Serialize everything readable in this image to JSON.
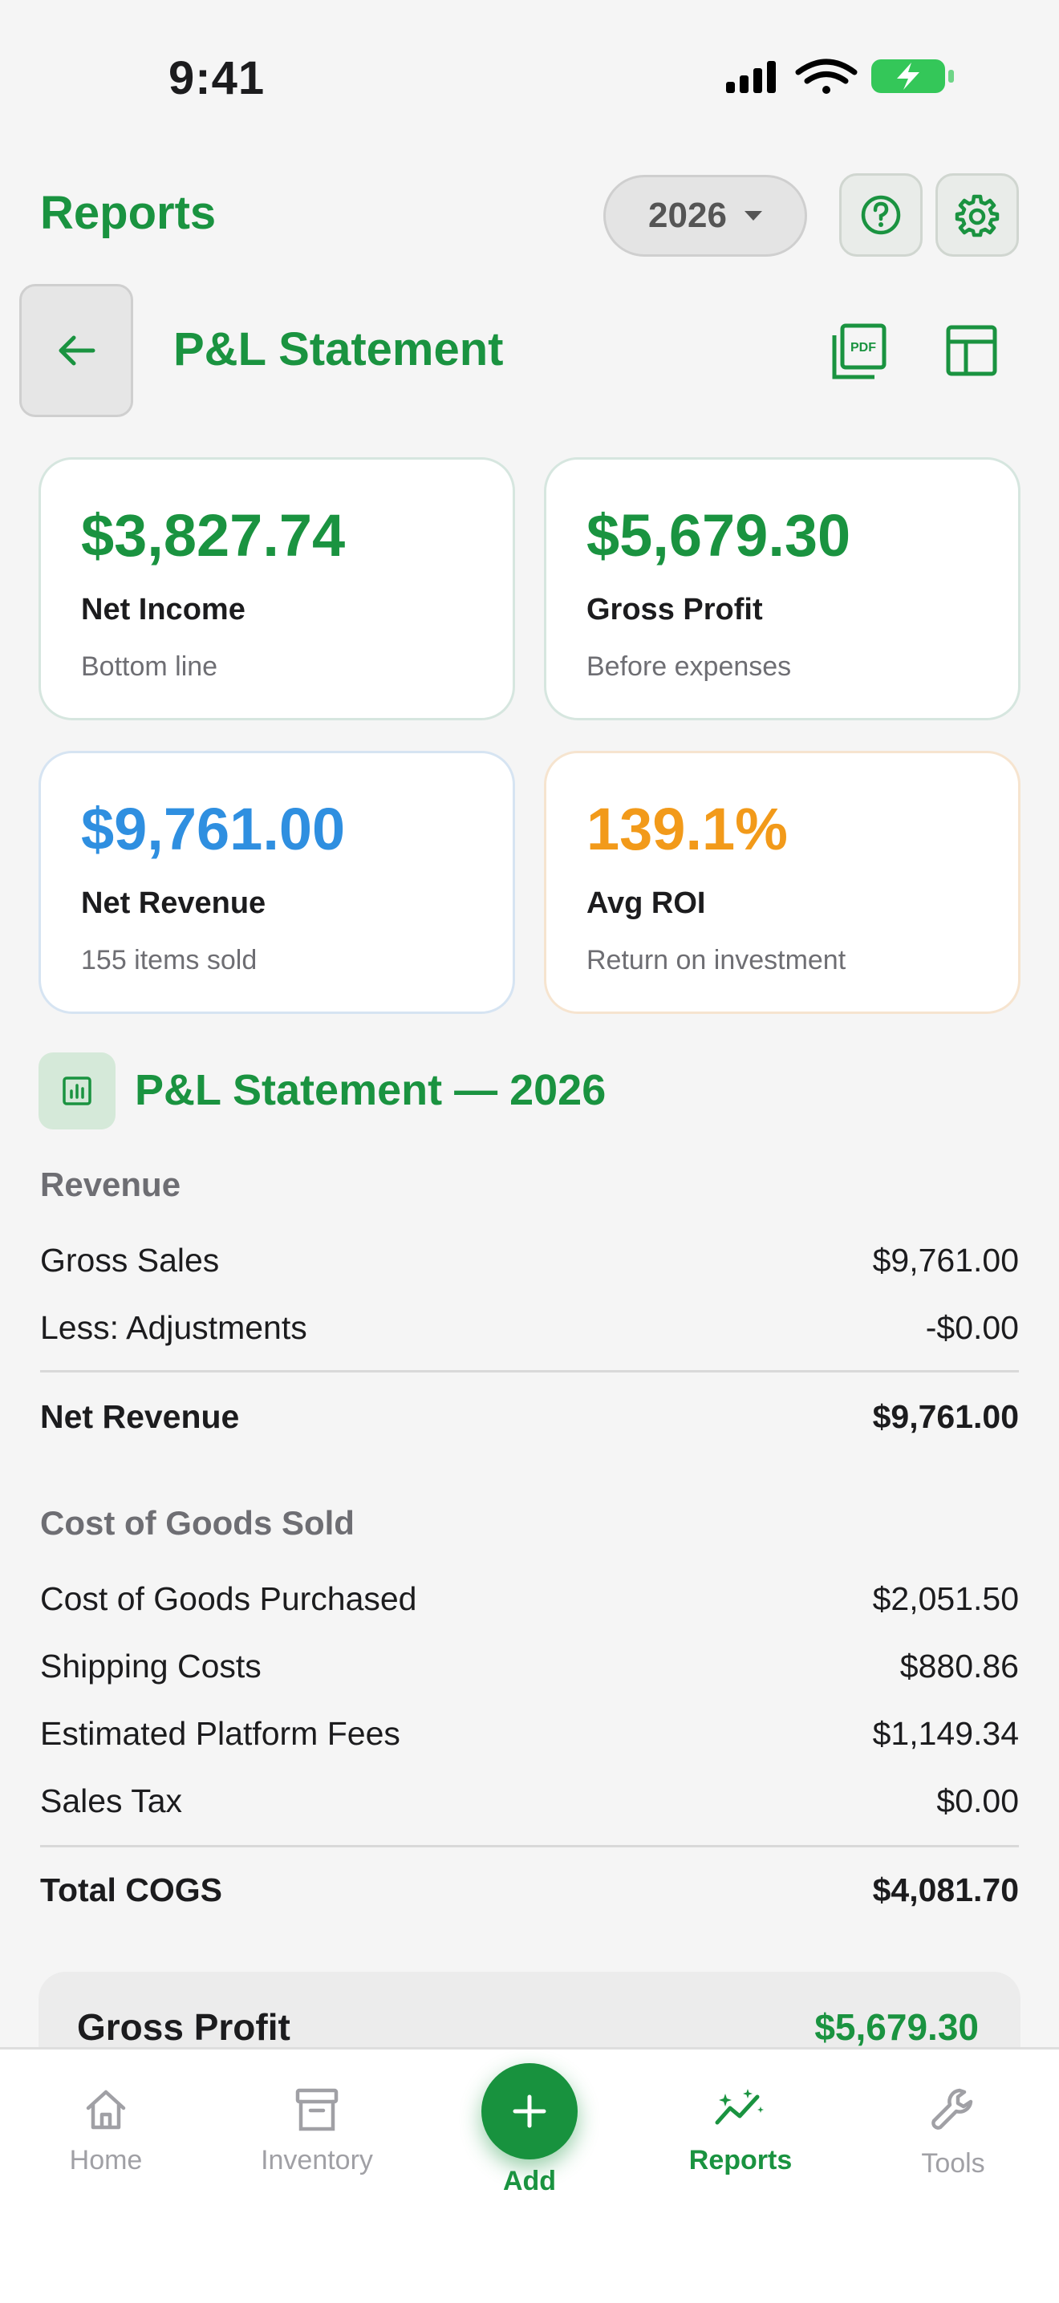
{
  "status_bar": {
    "time": "9:41"
  },
  "header": {
    "title": "Reports",
    "year": "2026"
  },
  "page": {
    "title": "P&L Statement"
  },
  "cards": [
    {
      "value": "$3,827.74",
      "label": "Net Income",
      "sub": "Bottom line",
      "color": "#1a9340",
      "border": "#d6e6df"
    },
    {
      "value": "$5,679.30",
      "label": "Gross Profit",
      "sub": "Before expenses",
      "color": "#1a9340",
      "border": "#d6e6df"
    },
    {
      "value": "$9,761.00",
      "label": "Net Revenue",
      "sub": "155 items sold",
      "color": "#2f8fe0",
      "border": "#d6e4f2"
    },
    {
      "value": "139.1%",
      "label": "Avg ROI",
      "sub": "Return on investment",
      "color": "#f29a1a",
      "border": "#f6e4cf"
    }
  ],
  "statement": {
    "title": "P&L Statement — 2026",
    "revenue": {
      "heading": "Revenue",
      "rows": [
        {
          "label": "Gross Sales",
          "value": "$9,761.00"
        },
        {
          "label": "Less: Adjustments",
          "value": "-$0.00"
        }
      ],
      "total": {
        "label": "Net Revenue",
        "value": "$9,761.00"
      }
    },
    "cogs": {
      "heading": "Cost of Goods Sold",
      "rows": [
        {
          "label": "Cost of Goods Purchased",
          "value": "$2,051.50"
        },
        {
          "label": "Shipping Costs",
          "value": "$880.86"
        },
        {
          "label": "Estimated Platform Fees",
          "value": "$1,149.34"
        },
        {
          "label": "Sales Tax",
          "value": "$0.00"
        }
      ],
      "total": {
        "label": "Total COGS",
        "value": "$4,081.70"
      }
    },
    "gross_profit": {
      "label": "Gross Profit",
      "value": "$5,679.30"
    }
  },
  "tabs": [
    {
      "label": "Home",
      "icon": "home-icon"
    },
    {
      "label": "Inventory",
      "icon": "archive-box-icon"
    },
    {
      "label": "Add",
      "icon": "plus-icon"
    },
    {
      "label": "Reports",
      "icon": "chart-sparkle-icon"
    },
    {
      "label": "Tools",
      "icon": "wrench-icon"
    }
  ],
  "colors": {
    "brand_green": "#1a9340",
    "blue": "#2f8fe0",
    "orange": "#f29a1a"
  }
}
